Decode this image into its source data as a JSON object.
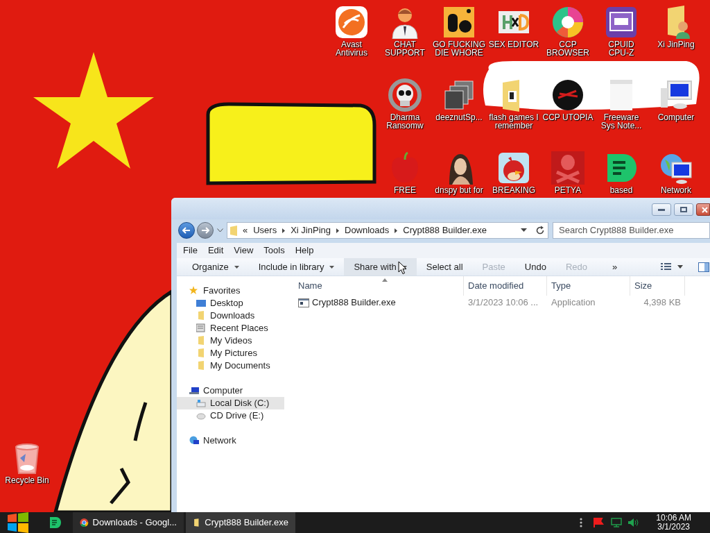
{
  "desktop": {
    "icons": [
      {
        "label": "Avast\nAntivirus"
      },
      {
        "label": "CHAT\nSUPPORT"
      },
      {
        "label": "GO FUCKING\nDIE WHORE"
      },
      {
        "label": "SEX EDITOR"
      },
      {
        "label": "CCP\nBROWSER"
      },
      {
        "label": "CPUID\nCPU-Z"
      },
      {
        "label": "Xi JinPing"
      },
      {
        "label": "Dharma\nRansomw"
      },
      {
        "label": "deeznutSp..."
      },
      {
        "label": "flash games I\nremember"
      },
      {
        "label": "CCP UTOPIA"
      },
      {
        "label": "Freeware\nSys Note..."
      },
      {
        "label": "Computer"
      },
      {
        "label": "FREE"
      },
      {
        "label": "dnspy but for"
      },
      {
        "label": "BREAKING"
      },
      {
        "label": "PETYA"
      },
      {
        "label": "based"
      },
      {
        "label": "Network"
      },
      {
        "label": "Recycle Bin"
      }
    ]
  },
  "explorer": {
    "breadcrumb_overflow": "«",
    "breadcrumb": [
      "Users",
      "Xi JinPing",
      "Downloads",
      "Crypt888 Builder.exe"
    ],
    "search": {
      "placeholder": "Search Crypt888 Builder.exe"
    },
    "menu": [
      "File",
      "Edit",
      "View",
      "Tools",
      "Help"
    ],
    "commands": [
      {
        "label": "Organize",
        "dropdown": true,
        "disabled": false,
        "highlighted": false
      },
      {
        "label": "Include in library",
        "dropdown": true,
        "disabled": false,
        "highlighted": false
      },
      {
        "label": "Share with",
        "dropdown": true,
        "disabled": false,
        "highlighted": true
      },
      {
        "label": "Select all",
        "dropdown": false,
        "disabled": false,
        "highlighted": false
      },
      {
        "label": "Paste",
        "dropdown": false,
        "disabled": true,
        "highlighted": false
      },
      {
        "label": "Undo",
        "dropdown": false,
        "disabled": false,
        "highlighted": false
      },
      {
        "label": "Redo",
        "dropdown": false,
        "disabled": true,
        "highlighted": false
      }
    ],
    "more": "»",
    "navigation": [
      {
        "label": "Favorites",
        "selected": false,
        "children": [
          {
            "label": "Desktop",
            "selected": false
          },
          {
            "label": "Downloads",
            "selected": false
          },
          {
            "label": "Recent Places",
            "selected": false
          },
          {
            "label": "My Videos",
            "selected": false
          },
          {
            "label": "My Pictures",
            "selected": false
          },
          {
            "label": "My Documents",
            "selected": false
          }
        ]
      },
      {
        "label": "Computer",
        "selected": false,
        "children": [
          {
            "label": "Local Disk (C:)",
            "selected": true
          },
          {
            "label": "CD Drive (E:)",
            "selected": false
          }
        ]
      },
      {
        "label": "Network",
        "selected": false
      }
    ],
    "columns": [
      "Name",
      "Date modified",
      "Type",
      "Size"
    ],
    "rows": [
      {
        "name": "Crypt888 Builder.exe",
        "date": "3/1/2023 10:06 ...",
        "type": "Application",
        "size": "4,398 KB"
      }
    ]
  },
  "taskbar": {
    "tasks": [
      {
        "label": "Downloads - Googl...",
        "selected": false
      },
      {
        "label": "Crypt888 Builder.exe",
        "selected": true
      }
    ],
    "clock": {
      "time": "10:06 AM",
      "date": "3/1/2023"
    }
  }
}
